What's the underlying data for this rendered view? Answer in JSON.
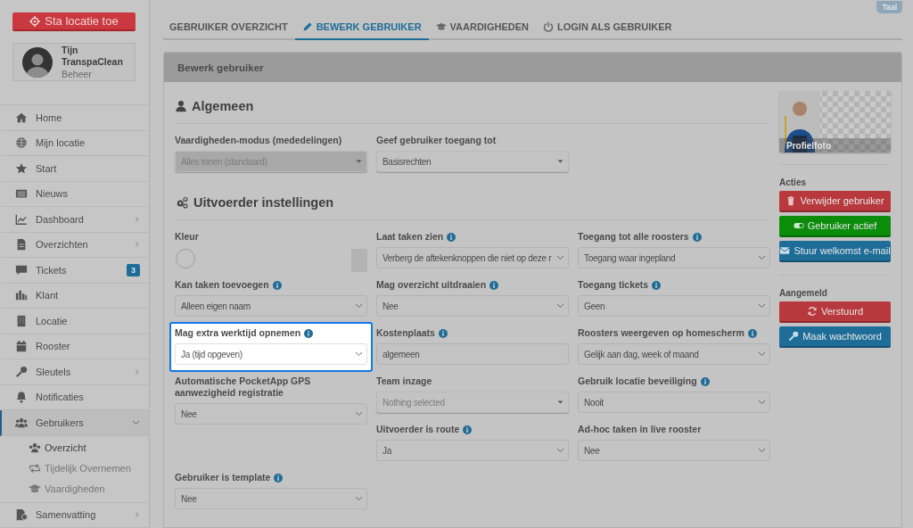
{
  "sidebar": {
    "location_button": "Sta locatie toe",
    "user": {
      "name": "Tijn TranspaClean",
      "role": "Beheer"
    },
    "items": [
      {
        "label": "Home",
        "selected": false
      },
      {
        "label": "Mijn locatie",
        "selected": false
      },
      {
        "label": "Start",
        "selected": false
      },
      {
        "label": "Nieuws",
        "selected": false
      },
      {
        "label": "Dashboard",
        "expanded": false,
        "selected": false
      },
      {
        "label": "Overzichten",
        "expanded": false,
        "selected": false
      },
      {
        "label": "Tickets",
        "selected": false,
        "badge": "3"
      },
      {
        "label": "Klant",
        "selected": false
      },
      {
        "label": "Locatie",
        "selected": false
      },
      {
        "label": "Rooster",
        "selected": false
      },
      {
        "label": "Sleutels",
        "expanded": false,
        "selected": false
      },
      {
        "label": "Notificaties",
        "selected": false
      },
      {
        "label": "Gebruikers",
        "expanded": true,
        "selected": true,
        "children": [
          {
            "label": "Overzicht",
            "selected": true
          },
          {
            "label": "Tijdelijk Overnemen",
            "selected": false
          },
          {
            "label": "Vaardigheden",
            "selected": false
          }
        ]
      },
      {
        "label": "Samenvatting",
        "expanded": false,
        "selected": false
      }
    ]
  },
  "language_button": "Taal",
  "tabs": [
    {
      "label": "GEBRUIKER OVERZICHT",
      "selected": false
    },
    {
      "label": "BEWERK GEBRUIKER",
      "selected": true
    },
    {
      "label": "VAARDIGHEDEN",
      "selected": false
    },
    {
      "label": "LOGIN ALS GEBRUIKER",
      "selected": false
    }
  ],
  "panel": {
    "title": "Bewerk gebruiker",
    "general": {
      "heading": "Algemeen",
      "fields": [
        {
          "kind": "dropdown",
          "label": "Vaardigheden-modus (mededelingen)",
          "value": "Alles tonen (standaard)",
          "disabled": true,
          "info": false,
          "highlighted": false
        },
        {
          "kind": "dropdown",
          "label": "Geef gebruiker toegang tot",
          "value": "Basisrechten",
          "disabled": false,
          "info": false,
          "highlighted": false
        }
      ]
    },
    "executor": {
      "heading": "Uitvoerder instellingen",
      "fields": [
        {
          "kind": "color",
          "label": "Kleur",
          "disabled": false,
          "info": false,
          "highlighted": false
        },
        {
          "kind": "select",
          "label": "Laat taken zien",
          "value": "Verberg de aftekenknoppen die niet op deze r",
          "disabled": false,
          "info": true,
          "highlighted": false
        },
        {
          "kind": "select",
          "label": "Toegang tot alle roosters",
          "value": "Toegang waar ingepland",
          "disabled": false,
          "info": true,
          "highlighted": false
        },
        {
          "kind": "select",
          "label": "Kan taken toevoegen",
          "value": "Alleen eigen naam",
          "disabled": false,
          "info": true,
          "highlighted": false
        },
        {
          "kind": "select",
          "label": "Mag overzicht uitdraaien",
          "value": "Nee",
          "disabled": false,
          "info": true,
          "highlighted": false
        },
        {
          "kind": "select",
          "label": "Toegang tickets",
          "value": "Geen",
          "disabled": false,
          "info": true,
          "highlighted": false
        },
        {
          "kind": "select",
          "label": "Mag extra werktijd opnemen",
          "value": "Ja (tijd opgeven)",
          "disabled": false,
          "info": true,
          "highlighted": true
        },
        {
          "kind": "text",
          "label": "Kostenplaats",
          "value": "algemeen",
          "disabled": false,
          "info": true,
          "highlighted": false
        },
        {
          "kind": "select",
          "label": "Roosters weergeven op homescherm",
          "value": "Gelijk aan dag, week of maand",
          "disabled": false,
          "info": true,
          "highlighted": false
        },
        {
          "kind": "select",
          "label": "Automatische PocketApp GPS aanwezigheid registratie",
          "value": "Nee",
          "disabled": false,
          "info": false,
          "highlighted": false
        },
        {
          "kind": "dropdown",
          "label": "Team inzage",
          "placeholder": "Nothing selected",
          "disabled": false,
          "info": false,
          "highlighted": false
        },
        {
          "kind": "select",
          "label": "Gebruik locatie beveiliging",
          "value": "Nooit",
          "disabled": false,
          "info": true,
          "highlighted": false
        },
        {
          "kind": "empty"
        },
        {
          "kind": "select",
          "label": "Uitvoerder is route",
          "value": "Ja",
          "disabled": false,
          "info": true,
          "highlighted": false
        },
        {
          "kind": "select",
          "label": "Ad-hoc taken in live rooster",
          "value": "Nee",
          "disabled": false,
          "info": false,
          "highlighted": false
        },
        {
          "kind": "select",
          "label": "Gebruiker is template",
          "value": "Nee",
          "disabled": false,
          "info": true,
          "highlighted": false
        }
      ]
    },
    "photo_caption": "Profielfoto",
    "actions": {
      "heading": "Acties",
      "buttons": [
        {
          "label": "Verwijder gebruiker",
          "color": "#b8393d"
        },
        {
          "label": "Gebruiker actief",
          "color": "#0b8c0b"
        },
        {
          "label": "Stuur welkomst e-mail",
          "color": "#1e6d98"
        }
      ]
    },
    "signed_in": {
      "heading": "Aangemeld",
      "buttons": [
        {
          "label": "Verstuurd",
          "color": "#b8393d"
        },
        {
          "label": "Maak wachtwoord",
          "color": "#1e6d98"
        }
      ]
    }
  }
}
